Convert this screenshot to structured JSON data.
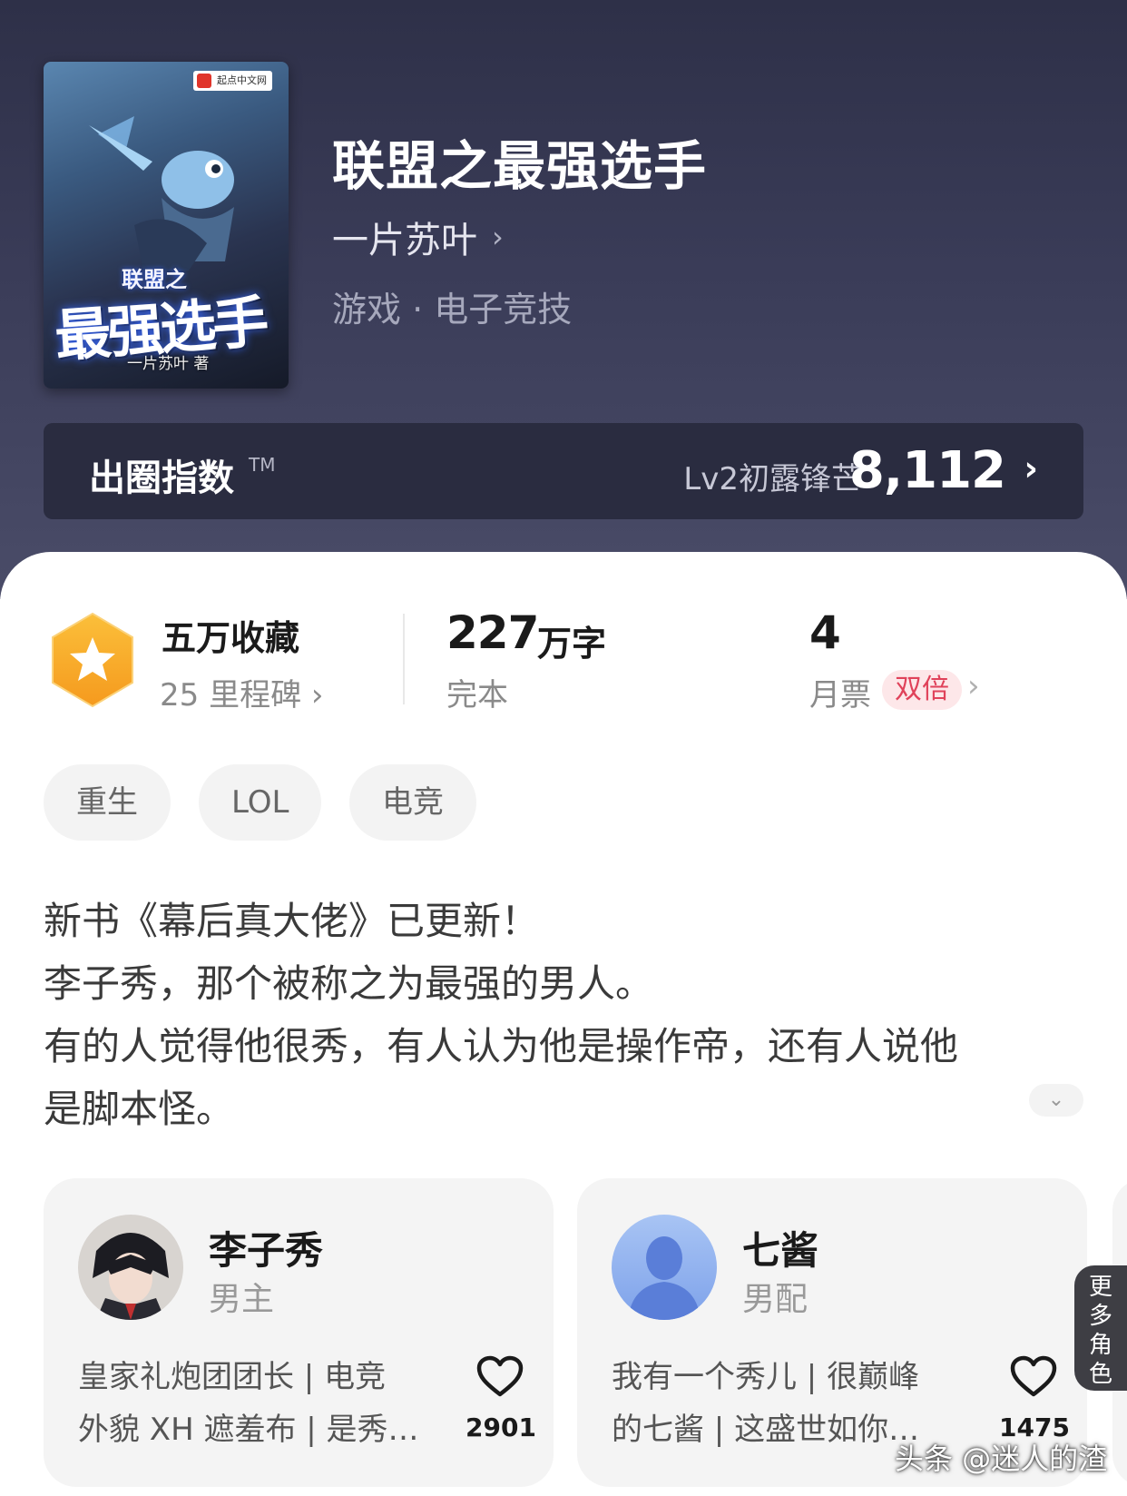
{
  "book": {
    "title": "联盟之最强选手",
    "author": "一片苏叶",
    "author_chevron": "›",
    "genre": "游戏 · 电子竞技",
    "cover": {
      "publisher": "起点中文网",
      "title_small": "联盟之",
      "title_big": "最强选手",
      "author_sig": "一片苏叶 著"
    }
  },
  "index_bar": {
    "label": "出圈指数",
    "tm": "TM",
    "level": "Lv2初露锋芒",
    "score": "8,112",
    "chevron": "›"
  },
  "stats": {
    "collection_title": "五万收藏",
    "collection_sub": "25 里程碑 ›",
    "word_count": "227",
    "word_unit": "万字",
    "status": "完本",
    "monthly_votes": "4",
    "monthly_label": "月票",
    "double_badge": "双倍",
    "chevron": "›"
  },
  "tags": [
    "重生",
    "LOL",
    "电竞"
  ],
  "description": [
    "新书《幕后真大佬》已更新！",
    "李子秀，那个被称之为最强的男人。",
    "有的人觉得他很秀，有人认为他是操作帝，还有人说他",
    "是脚本怪。"
  ],
  "expand_icon": "⌄",
  "characters": [
    {
      "name": "李子秀",
      "role": "男主",
      "desc_line1": "皇家礼炮团团长 | 电竞",
      "desc_line2": "外貌 XH 遮羞布 | 是秀…",
      "likes": "2901"
    },
    {
      "name": "七酱",
      "role": "男配",
      "desc_line1": "我有一个秀儿 | 很巅峰",
      "desc_line2": "的七酱 | 这盛世如你…",
      "likes": "1475"
    }
  ],
  "more_characters": "更多角色",
  "watermark": "头条 @迷人的渣",
  "colors": {
    "header_bg": "#3a3c58",
    "index_bar_bg": "#2a2c40",
    "badge_orange": "#f7a928",
    "double_badge_text": "#e0425a",
    "card_bg": "#f4f4f4"
  }
}
